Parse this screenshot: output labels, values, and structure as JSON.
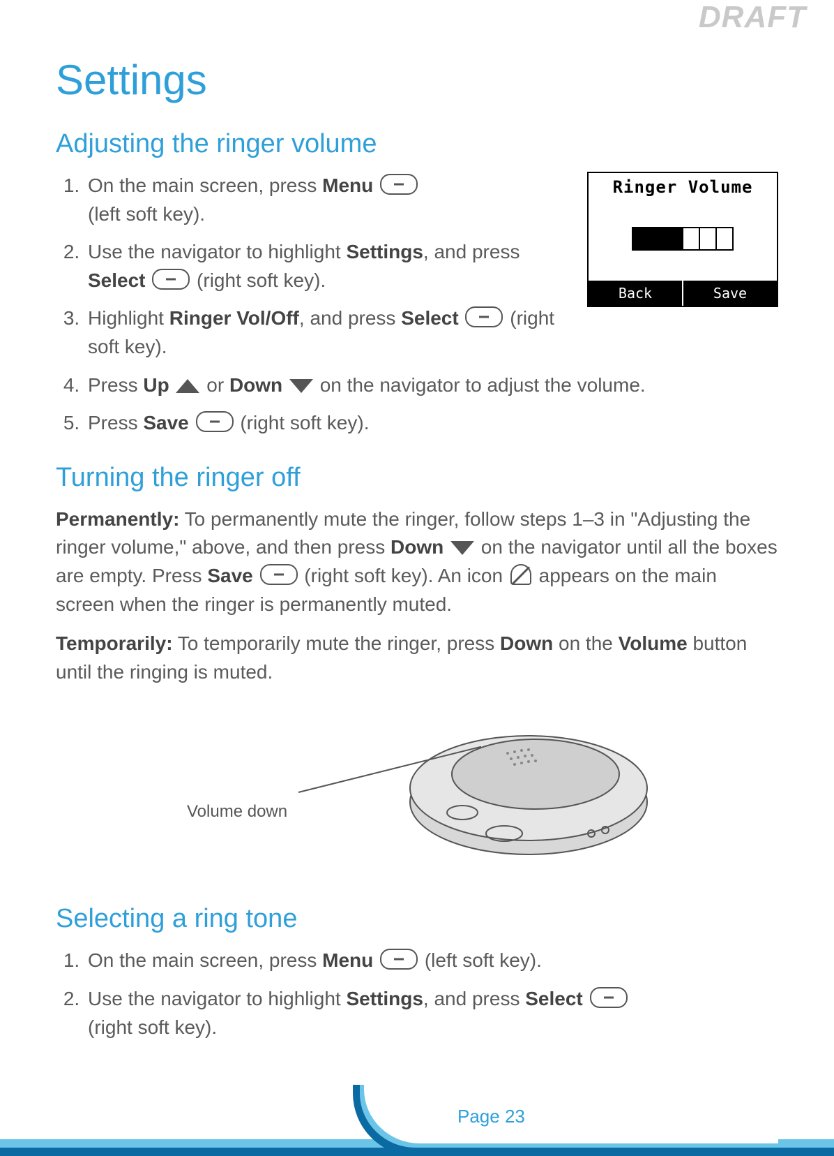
{
  "watermark": "DRAFT",
  "page_title": "Settings",
  "section1": {
    "heading": "Adjusting the ringer volume",
    "steps": {
      "s1a": "On the main screen, press ",
      "s1b": "Menu",
      "s1c": " (left soft key).",
      "s2a": "Use the navigator to highlight ",
      "s2b": "Settings",
      "s2c": ", and press ",
      "s2d": "Select",
      "s2e": " (right soft key).",
      "s3a": "Highlight ",
      "s3b": "Ringer Vol/Off",
      "s3c": ", and press ",
      "s3d": "Select",
      "s3e": " (right soft key).",
      "s4a": "Press ",
      "s4b": "Up",
      "s4c": " or ",
      "s4d": "Down",
      "s4e": " on the navigator to adjust the volume.",
      "s5a": "Press ",
      "s5b": "Save",
      "s5c": " (right soft key)."
    }
  },
  "phone_screen": {
    "title": "Ringer Volume",
    "filled_boxes": 3,
    "total_boxes": 6,
    "left_key": "Back",
    "right_key": "Save"
  },
  "section2": {
    "heading": "Turning the ringer off",
    "perm_label": "Permanently:",
    "perm_text1": " To permanently  mute the ringer, follow steps 1–3 in \"Adjusting the ringer volume,\" above, and then press ",
    "perm_down": "Down",
    "perm_text2": " on the navigator until all the boxes are empty. Press ",
    "perm_save": "Save",
    "perm_text3": " (right soft key). An icon ",
    "perm_text4": " appears on the main screen when the ringer is permanently muted.",
    "temp_label": "Temporarily:",
    "temp_text1": " To temporarily mute the ringer, press ",
    "temp_down": "Down",
    "temp_text2": " on the ",
    "temp_volume": "Volume",
    "temp_text3": " button until the ringing is muted."
  },
  "callout_label": "Volume down",
  "section3": {
    "heading": "Selecting a ring tone",
    "steps": {
      "s1a": "On the main screen, press ",
      "s1b": "Menu",
      "s1c": " (left soft key).",
      "s2a": "Use the navigator to highlight ",
      "s2b": "Settings",
      "s2c": ", and press ",
      "s2d": "Select",
      "s2e": " (right soft key)."
    }
  },
  "page_number": "Page 23"
}
